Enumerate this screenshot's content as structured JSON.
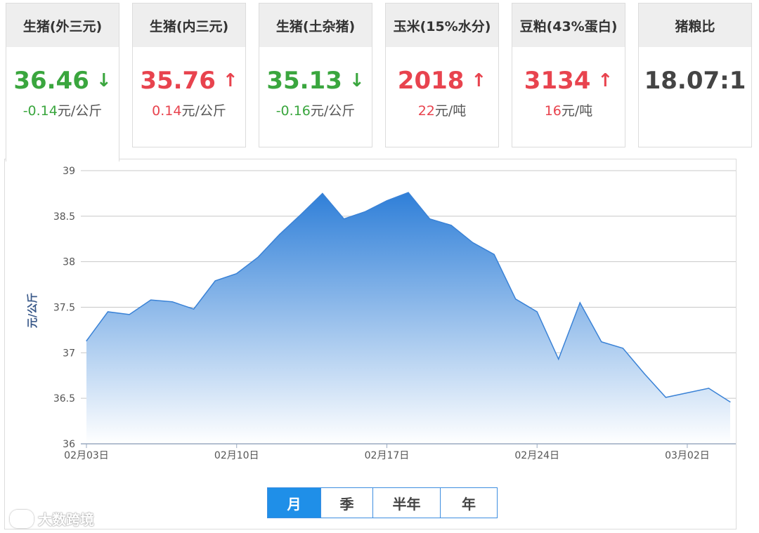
{
  "cards": [
    {
      "title": "生猪(外三元)",
      "value": "36.46",
      "dir": "down",
      "change": "-0.14",
      "unit": "元/公斤",
      "active": true
    },
    {
      "title": "生猪(内三元)",
      "value": "35.76",
      "dir": "up",
      "change": "0.14",
      "unit": "元/公斤",
      "active": false
    },
    {
      "title": "生猪(土杂猪)",
      "value": "35.13",
      "dir": "down",
      "change": "-0.16",
      "unit": "元/公斤",
      "active": false
    },
    {
      "title": "玉米(15%水分)",
      "value": "2018",
      "dir": "up",
      "change": "22",
      "unit": "元/吨",
      "active": false
    },
    {
      "title": "豆粕(43%蛋白)",
      "value": "3134",
      "dir": "up",
      "change": "16",
      "unit": "元/吨",
      "active": false
    },
    {
      "title": "猪粮比",
      "value": "18.07:1",
      "dir": "none",
      "change": "",
      "unit": "",
      "active": false
    }
  ],
  "colors": {
    "up": "#e8434e",
    "down": "#3aa63e",
    "accent": "#1f8fe8",
    "area_top": "#2f7fd8",
    "area_bottom": "#ffffff",
    "line": "#3a82d6"
  },
  "range_buttons": [
    {
      "label": "月",
      "selected": true
    },
    {
      "label": "季",
      "selected": false
    },
    {
      "label": "半年",
      "selected": false
    },
    {
      "label": "年",
      "selected": false
    }
  ],
  "watermark": "大数跨境",
  "chart_data": {
    "type": "area",
    "ylabel": "元/公斤",
    "ylim": [
      36,
      39
    ],
    "yticks": [
      "36",
      "36.5",
      "37",
      "37.5",
      "38",
      "38.5",
      "39"
    ],
    "xtick_labels": [
      "02月03日",
      "02月10日",
      "02月17日",
      "02月24日",
      "03月02日"
    ],
    "xtick_days": [
      0,
      7,
      14,
      21,
      28
    ],
    "x": [
      "02-03",
      "02-04",
      "02-05",
      "02-06",
      "02-07",
      "02-08",
      "02-09",
      "02-10",
      "02-11",
      "02-12",
      "02-13",
      "02-14",
      "02-15",
      "02-16",
      "02-17",
      "02-18",
      "02-19",
      "02-20",
      "02-21",
      "02-22",
      "02-23",
      "02-24",
      "02-25",
      "02-26",
      "02-27",
      "02-28",
      "02-29",
      "03-01",
      "03-02",
      "03-03",
      "03-04"
    ],
    "values": [
      37.13,
      37.45,
      37.42,
      37.58,
      37.56,
      37.48,
      37.79,
      37.87,
      38.05,
      38.3,
      38.52,
      38.75,
      38.47,
      38.55,
      38.67,
      38.76,
      38.47,
      38.4,
      38.21,
      38.08,
      37.59,
      37.45,
      36.93,
      37.55,
      37.12,
      37.05,
      36.77,
      36.51,
      36.56,
      36.61,
      36.46
    ],
    "grid": true
  }
}
